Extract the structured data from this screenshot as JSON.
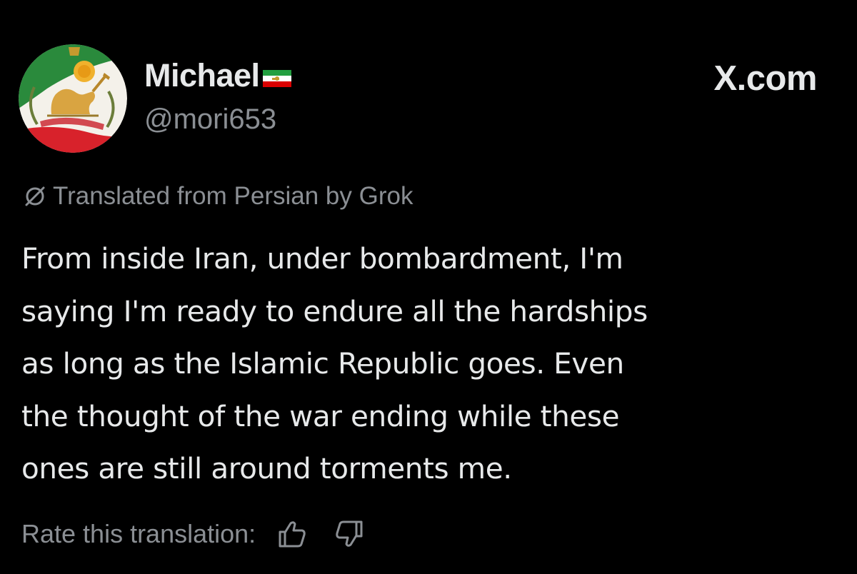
{
  "header": {
    "display_name": "Michael",
    "flag_icon": "iran-lion-sun-flag-icon",
    "handle": "@mori653",
    "brand": "X.com",
    "avatar_icon": "lion-and-sun-emblem-avatar"
  },
  "translation": {
    "icon": "translate-icon",
    "label": "Translated from Persian by Grok"
  },
  "tweet": {
    "lines": [
      "From inside Iran, under bombardment, I'm",
      "saying I'm ready to endure all the hardships",
      "as long as the Islamic Republic goes. Even",
      "the thought of the war ending while these",
      "ones are still around torments me."
    ]
  },
  "rating": {
    "label": "Rate this translation:",
    "up_icon": "thumbs-up-icon",
    "down_icon": "thumbs-down-icon"
  },
  "colors": {
    "background": "#000000",
    "primary_text": "#e7e9ea",
    "secondary_text": "#8b8f94",
    "flag_green": "#239f40",
    "flag_white": "#ffffff",
    "flag_red": "#da0000"
  }
}
